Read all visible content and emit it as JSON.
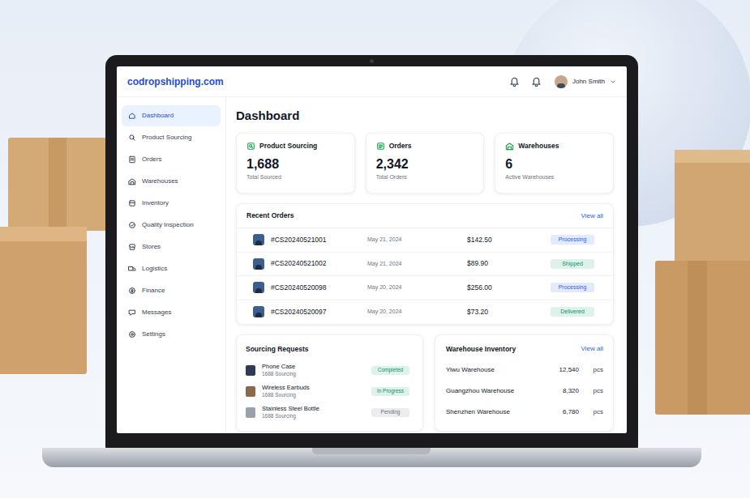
{
  "brand": "codropshipping.com",
  "user": {
    "name": "John Smith"
  },
  "sidebar": {
    "items": [
      {
        "label": "Dashboard",
        "selected": true
      },
      {
        "label": "Product Sourcing",
        "selected": false
      },
      {
        "label": "Orders",
        "selected": false
      },
      {
        "label": "Warehouses",
        "selected": false
      },
      {
        "label": "Inventory",
        "selected": false
      },
      {
        "label": "Quality Inspection",
        "selected": false
      },
      {
        "label": "Stores",
        "selected": false
      },
      {
        "label": "Logistics",
        "selected": false
      },
      {
        "label": "Finance",
        "selected": false
      },
      {
        "label": "Messages",
        "selected": false
      },
      {
        "label": "Settings",
        "selected": false
      }
    ]
  },
  "page_title": "Dashboard",
  "stats": [
    {
      "title": "Product Sourcing",
      "value": "1,688",
      "caption": "Total Sourced"
    },
    {
      "title": "Orders",
      "value": "2,342",
      "caption": "Total Orders"
    },
    {
      "title": "Warehouses",
      "value": "6",
      "caption": "Active Warehouses"
    }
  ],
  "recent_orders": {
    "title": "Recent Orders",
    "view_all": "View all",
    "rows": [
      {
        "id": "#CS20240521001",
        "date": "May 21, 2024",
        "amount": "$142.50",
        "status": "Processing",
        "color": "#2563eb"
      },
      {
        "id": "#CS20240521002",
        "date": "May 21, 2024",
        "amount": "$89.90",
        "status": "Shipped",
        "color": "#059669"
      },
      {
        "id": "#CS20240520098",
        "date": "May 20, 2024",
        "amount": "$256.00",
        "status": "Processing",
        "color": "#2563eb"
      },
      {
        "id": "#CS20240520097",
        "date": "May 20, 2024",
        "amount": "$73.20",
        "status": "Delivered",
        "color": "#059669"
      }
    ]
  },
  "sourcing_requests": {
    "title": "Sourcing Requests",
    "items": [
      {
        "name": "Phone Case",
        "source": "1688 Sourcing",
        "status": "Completed",
        "color": "#059669"
      },
      {
        "name": "Wireless Earbuds",
        "source": "1688 Sourcing",
        "status": "In Progress",
        "color": "#059669"
      },
      {
        "name": "Stainless Steel Bottle",
        "source": "1688 Sourcing",
        "status": "Pending",
        "color": "#6b7280"
      }
    ]
  },
  "warehouse_inventory": {
    "title": "Warehouse Inventory",
    "view_all": "View all",
    "rows": [
      {
        "name": "Yiwu Warehouse",
        "quantity": "12,540",
        "unit": "pcs"
      },
      {
        "name": "Guangzhou Warehouse",
        "quantity": "8,320",
        "unit": "pcs"
      },
      {
        "name": "Shenzhen Warehouse",
        "quantity": "6,780",
        "unit": "pcs"
      }
    ]
  }
}
